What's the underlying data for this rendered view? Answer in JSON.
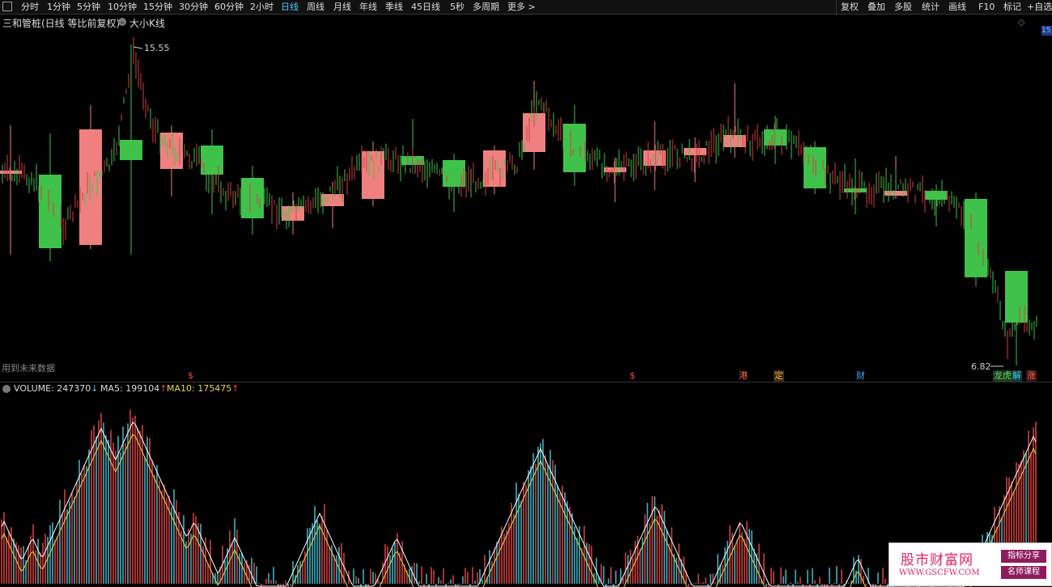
{
  "toolbar": {
    "periods": [
      "分时",
      "1分钟",
      "5分钟",
      "10分钟",
      "15分钟",
      "30分钟",
      "60分钟",
      "2小时",
      "日线",
      "周线",
      "月线",
      "年线",
      "季线",
      "45日线",
      "5秒",
      "多周期",
      "更多 >"
    ],
    "active_period": "日线",
    "right_items": [
      "复权",
      "叠加",
      "多股",
      "统计",
      "画线",
      "F10",
      "标记",
      "+自选"
    ]
  },
  "title": {
    "stock": "三和管桩(日线 等比前复权)",
    "indicator": "大小K线",
    "right_badge": "15"
  },
  "price_labels": {
    "high": "15.55",
    "low": "6.82"
  },
  "notes": {
    "future_data": "用到未来数据"
  },
  "events": [
    {
      "text": "$",
      "color": "#ff4444"
    },
    {
      "text": "$",
      "color": "#ff4444"
    },
    {
      "text": "港",
      "color": "#ff6a5a"
    },
    {
      "text": "定",
      "color": "#f0a050"
    },
    {
      "text": "财",
      "color": "#4fa3ff"
    },
    {
      "text": "龙虎榜",
      "color": "#5ad46a"
    },
    {
      "text": "解",
      "color": "#3fd0d0"
    },
    {
      "text": "涨",
      "color": "#ff6a5a"
    }
  ],
  "volume": {
    "label": "VOLUME: 247370",
    "ma5": "MA5: 199104",
    "ma10": "MA10: 175475",
    "arrow_down": "↓",
    "arrow_up": "↑"
  },
  "watermark": {
    "title": "股市财富网",
    "url": "WWW.GSCFW.COM",
    "tag1": "指标分享",
    "tag2": "名师课程"
  },
  "colors": {
    "up": "#f08080",
    "down": "#3fc24a",
    "thin_up": "#d04040",
    "thin_down": "#3fb0c0",
    "ma5": "#ffffff",
    "ma10": "#e6d84a"
  }
}
